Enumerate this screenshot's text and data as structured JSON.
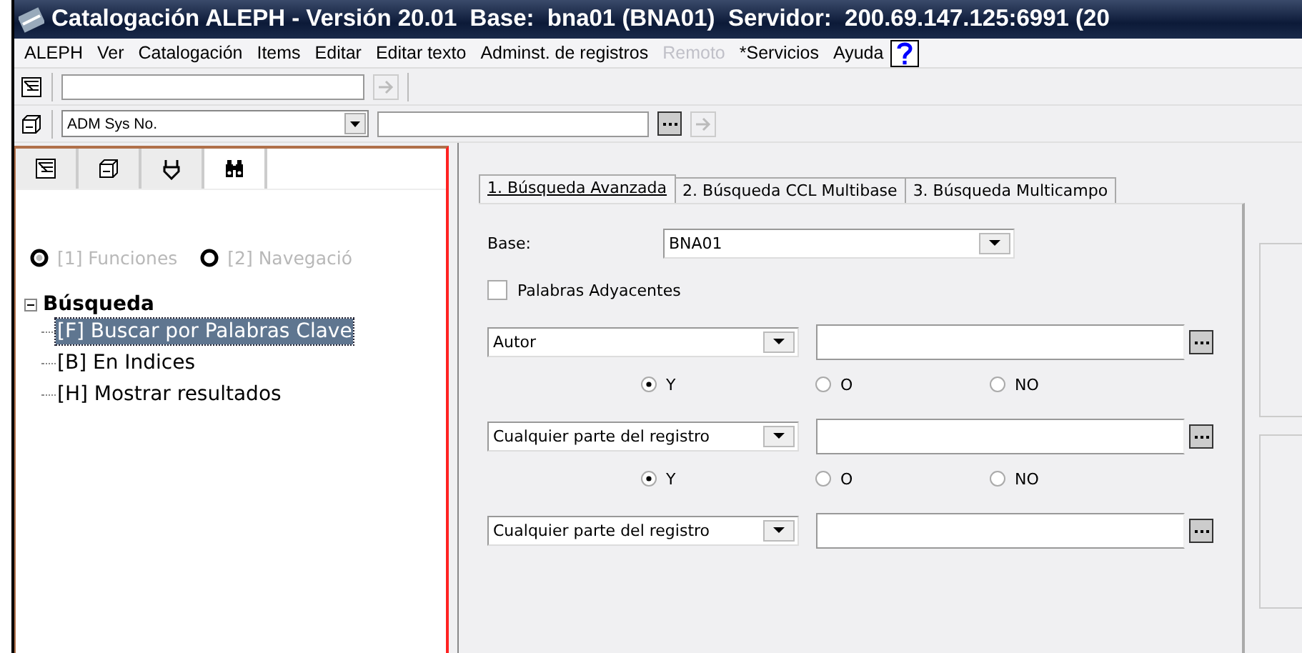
{
  "window": {
    "title": "Catalogación ALEPH - Versión 20.01  Base:  bna01 (BNA01)  Servidor:  200.69.147.125:6991 (20"
  },
  "menu": [
    {
      "label": "ALEPH",
      "disabled": false
    },
    {
      "label": "Ver",
      "disabled": false
    },
    {
      "label": "Catalogación",
      "disabled": false
    },
    {
      "label": "Items",
      "disabled": false
    },
    {
      "label": "Editar",
      "disabled": false
    },
    {
      "label": "Editar texto",
      "disabled": false
    },
    {
      "label": "Adminst. de registros",
      "disabled": false
    },
    {
      "label": "Remoto",
      "disabled": true
    },
    {
      "label": "*Servicios",
      "disabled": false
    },
    {
      "label": "Ayuda",
      "disabled": false
    }
  ],
  "toolbar": {
    "record_type": "ADM Sys No."
  },
  "sidebar": {
    "tabs": [
      {
        "selected": false
      },
      {
        "selected": false
      },
      {
        "selected": false
      },
      {
        "selected": true
      }
    ],
    "modes": [
      {
        "label": "[1] Funciones",
        "selected": true
      },
      {
        "label": "[2] Navegació",
        "selected": false
      }
    ],
    "tree": [
      {
        "label": "Búsqueda",
        "expanded": true,
        "children": [
          {
            "label": "[F] Buscar por Palabras Clave",
            "selected": true
          },
          {
            "label": "[B] En Indices",
            "selected": false
          },
          {
            "label": "[H] Mostrar resultados",
            "selected": false
          }
        ]
      }
    ]
  },
  "search": {
    "tabs": [
      {
        "label": "1. Búsqueda Avanzada",
        "selected": true
      },
      {
        "label": "2. Búsqueda CCL Multibase",
        "selected": false
      },
      {
        "label": "3. Búsqueda Multicampo",
        "selected": false
      }
    ],
    "base": {
      "label": "Base:",
      "value": "BNA01"
    },
    "adjacent": {
      "label": "Palabras Adyacentes",
      "checked": false
    },
    "rows": [
      {
        "field": "Autor",
        "operators": [
          {
            "label": "Y",
            "selected": true
          },
          {
            "label": "O",
            "selected": false
          },
          {
            "label": "NO",
            "selected": false
          }
        ]
      },
      {
        "field": "Cualquier parte del registro",
        "operators": [
          {
            "label": "Y",
            "selected": true
          },
          {
            "label": "O",
            "selected": false
          },
          {
            "label": "NO",
            "selected": false
          }
        ]
      },
      {
        "field": "Cualquier parte del registro"
      }
    ]
  }
}
